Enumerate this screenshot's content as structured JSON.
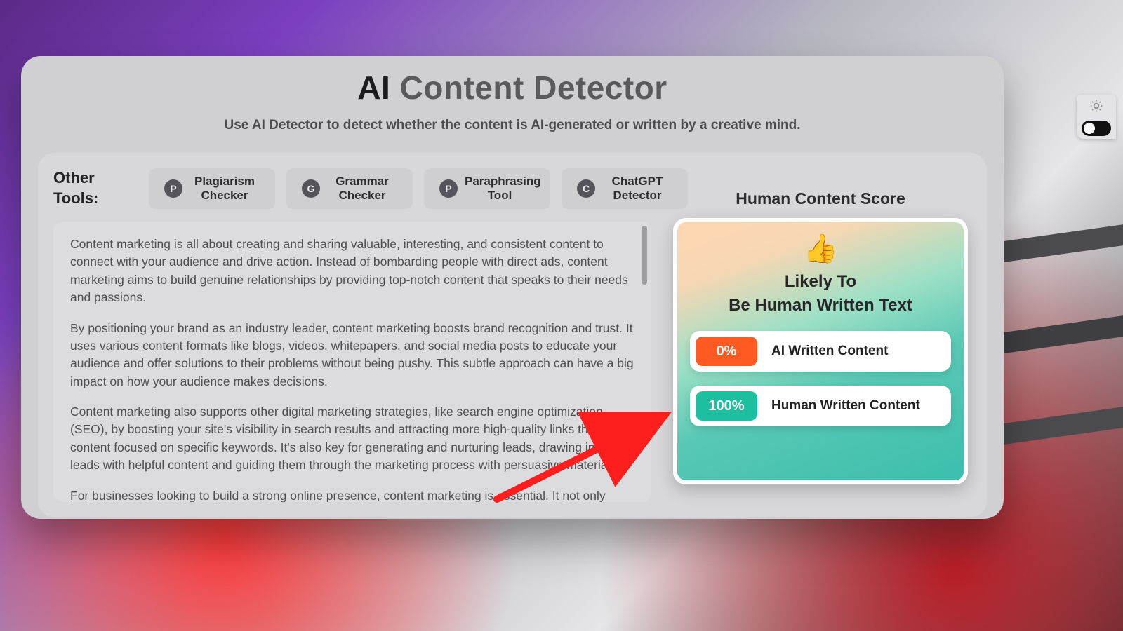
{
  "header": {
    "title_ai": "AI",
    "title_rest": " Content Detector",
    "subtitle": "Use AI Detector to detect whether the content is AI-generated or written by a creative mind."
  },
  "tools": {
    "label": "Other Tools:",
    "items": [
      {
        "badge": "P",
        "label": "Plagiarism Checker"
      },
      {
        "badge": "G",
        "label": "Grammar Checker"
      },
      {
        "badge": "P",
        "label": "Paraphrasing Tool"
      },
      {
        "badge": "C",
        "label": "ChatGPT Detector"
      }
    ]
  },
  "content": {
    "p1": "Content marketing is all about creating and sharing valuable, interesting, and consistent content to connect with your audience and drive action. Instead of bombarding people with direct ads, content marketing aims to build genuine relationships by providing top-notch content that speaks to their needs and passions.",
    "p2": "By positioning your brand as an industry leader, content marketing boosts brand recognition and trust. It uses various content formats like blogs, videos, whitepapers, and social media posts to educate your audience and offer solutions to their problems without being pushy. This subtle approach can have a big impact on how your audience makes decisions.",
    "p3": "Content marketing also supports other digital marketing strategies, like search engine optimization (SEO), by boosting your site's visibility in search results and attracting more high-quality links through content focused on specific keywords. It's also key for generating and nurturing leads, drawing in new leads with helpful content and guiding them through the marketing process with persuasive materials.",
    "p4": "For businesses looking to build a strong online presence, content marketing is essential. It not only helps your brand stand out in the market but also drives engagement with your target audience, leading to more conversions and loyal customers. That's why content marketing is a crucial part of any successful marketing"
  },
  "score": {
    "panel_title": "Human Content Score",
    "thumb_icon": "👍",
    "verdict_line1": "Likely To",
    "verdict_line2": "Be Human Written Text",
    "ai_pct": "0%",
    "ai_label": "AI Written Content",
    "human_pct": "100%",
    "human_label": "Human Written Content"
  },
  "colors": {
    "ai_pct_bg": "#ff5a22",
    "human_pct_bg": "#1cc0a0"
  }
}
